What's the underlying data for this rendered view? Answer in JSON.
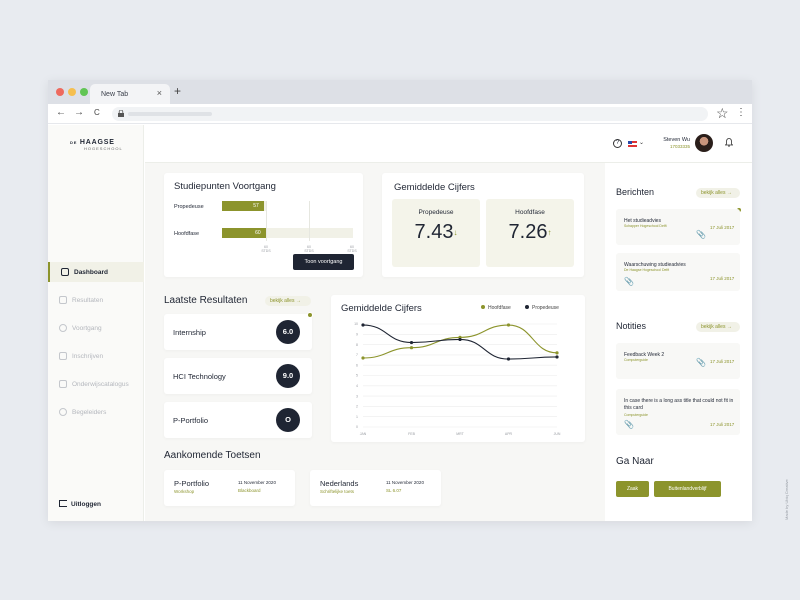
{
  "browser": {
    "tab_title": "New Tab",
    "tab_close": "×",
    "new_tab": "+",
    "nav_back": "←",
    "nav_forward": "→",
    "nav_reload": "C",
    "star": "☆",
    "menu": "⋮",
    "traffic_colors": [
      "#ee6a5e",
      "#f5bf4f",
      "#61c554"
    ]
  },
  "sidebar": {
    "logo_prefix": "DE",
    "logo_main": "HAAGSE",
    "logo_sub": "HOGESCHOOL",
    "items": [
      {
        "label": "Dashboard",
        "icon": "dashboard-icon",
        "active": true
      },
      {
        "label": "Resultaten",
        "icon": "clipboard-icon",
        "active": false
      },
      {
        "label": "Voortgang",
        "icon": "pie-chart-icon",
        "active": false
      },
      {
        "label": "Inschrijven",
        "icon": "document-icon",
        "active": false
      },
      {
        "label": "Onderwijscatalogus",
        "icon": "layers-icon",
        "active": false
      },
      {
        "label": "Begeleiders",
        "icon": "users-icon",
        "active": false
      }
    ],
    "logout": "Uitloggen"
  },
  "topbar": {
    "help": "?",
    "chevron": "⌄",
    "user_name": "Steven Wu",
    "user_id": "17033335",
    "bell": "🔔"
  },
  "studiepunten": {
    "title": "Studiepunten Voortgang",
    "bars": [
      {
        "label": "Propedeuse",
        "value": 57,
        "max": 60
      },
      {
        "label": "Hoofdfase",
        "value": 60,
        "max": 180
      }
    ],
    "ticks": [
      {
        "top": "60",
        "bottom": "STDS"
      },
      {
        "top": "60",
        "bottom": "STDS"
      },
      {
        "top": "60",
        "bottom": "STDS"
      }
    ],
    "button": "Toon voortgang"
  },
  "gemiddelde_top": {
    "title": "Gemiddelde Cijfers",
    "boxes": [
      {
        "label": "Propedeuse",
        "value": "7.43",
        "arrow": "↓"
      },
      {
        "label": "Hoofdfase",
        "value": "7.26",
        "arrow": "↑"
      }
    ]
  },
  "resultaten": {
    "title": "Laatste Resultaten",
    "link": "bekijk alles →",
    "items": [
      {
        "name": "Internship",
        "grade": "6.0"
      },
      {
        "name": "HCI Technology",
        "grade": "9.0"
      },
      {
        "name": "P-Portfolio",
        "grade": "O"
      }
    ]
  },
  "chart_data": {
    "type": "line",
    "title": "Gemiddelde Cijfers",
    "x": [
      "JAN",
      "FEB",
      "MRT",
      "APR",
      "JUN"
    ],
    "ylim": [
      0,
      10
    ],
    "yticks": [
      0,
      1,
      2,
      3,
      4,
      5,
      6,
      7,
      8,
      9,
      10
    ],
    "series": [
      {
        "name": "Hoofdfase",
        "color": "#8c942c",
        "values": [
          6.7,
          7.7,
          8.7,
          9.9,
          7.2
        ]
      },
      {
        "name": "Propedeuse",
        "color": "#1f2533",
        "values": [
          9.9,
          8.2,
          8.5,
          6.6,
          6.8
        ]
      }
    ],
    "legend": "top-right",
    "grid": true
  },
  "toetsen": {
    "title": "Aankomende Toetsen",
    "items": [
      {
        "name": "P-Portfolio",
        "sub": "Workshop",
        "date": "11 November 2020",
        "location": "Blackboard"
      },
      {
        "name": "Nederlands",
        "sub": "Schriftelijke toets",
        "date": "11 November 2020",
        "location": "SL 6.07"
      }
    ]
  },
  "berichten": {
    "title": "Berichten",
    "link": "bekijk alles →",
    "items": [
      {
        "title": "Het studieadvies",
        "sub": "Schapper Hogeschool Delft",
        "date": "17 Juli 2017"
      },
      {
        "title": "Waarschuwing studieadvies",
        "sub": "De Haagse Hogeschool Delft",
        "date": "17 Juli 2017"
      }
    ]
  },
  "notities": {
    "title": "Notities",
    "link": "bekijk alles →",
    "items": [
      {
        "title": "Feedback Week 2",
        "sub": "Computerguide",
        "date": "17 Juli 2017"
      },
      {
        "title": "In case there is a long ass title that could not fit in this card",
        "sub": "Computerguide",
        "date": "17 Juli 2017"
      }
    ]
  },
  "ga_naar": {
    "title": "Ga Naar",
    "buttons": [
      "Zaak",
      "Buitenlandverblijf"
    ]
  },
  "watermark": "Made by Ubiq Creative",
  "colors": {
    "accent": "#8c942c",
    "dark": "#1f2533",
    "bar_bg": "#f1f1e7"
  }
}
